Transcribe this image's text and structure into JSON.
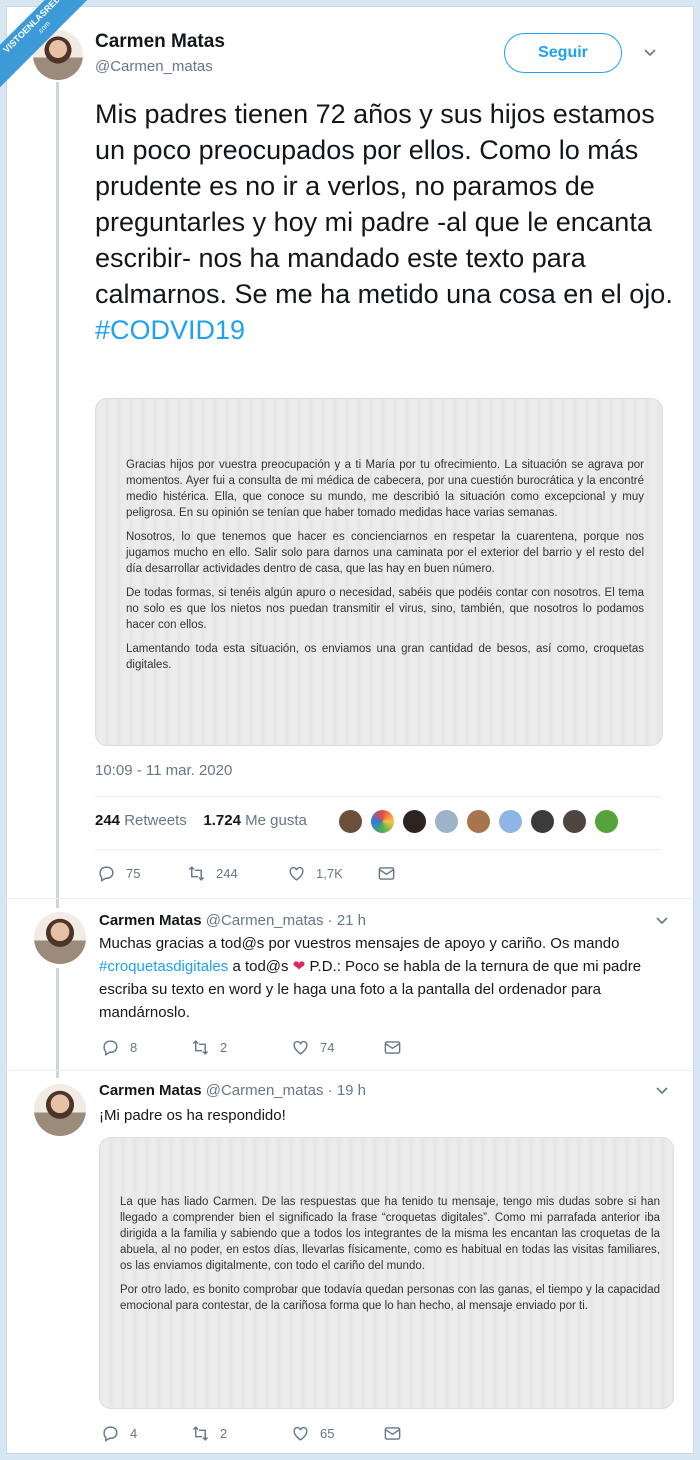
{
  "watermark": {
    "text": "VISTOENLASREDES",
    "sub": ".com"
  },
  "main_tweet": {
    "author_name": "Carmen Matas",
    "author_handle": "@Carmen_matas",
    "follow_label": "Seguir",
    "text": "Mis padres tienen 72 años y sus hijos estamos un poco preocupados por ellos. Como lo más prudente es no ir a verlos, no paramos de preguntarles y hoy mi padre -al que le encanta escribir- nos ha mandado este texto para calmarnos. Se me ha metido una cosa en el ojo.",
    "hashtag": "#CODVID19",
    "photo_paragraphs": [
      "Gracias hijos por vuestra preocupación y a ti María por tu ofrecimiento. La situación se agrava por momentos. Ayer fui a consulta de mi médica de cabecera, por una cuestión burocrática y la encontré medio histérica. Ella, que conoce su mundo, me describió la situación como excepcional y muy peligrosa. En su opinión se tenían que haber tomado medidas hace varias semanas.",
      "Nosotros, lo que tenemos que hacer es concienciarnos en respetar la cuarentena, porque nos jugamos mucho en ello. Salir solo para darnos una caminata por el exterior del barrio y el resto del día desarrollar actividades dentro de casa, que las hay en buen número.",
      "De todas formas, si tenéis algún apuro o necesidad, sabéis que podéis contar con nosotros. El tema no solo es que los nietos nos puedan transmitir el virus, sino, también, que nosotros lo podamos hacer con ellos.",
      "Lamentando toda esta situación, os enviamos una gran cantidad de besos, así como, croquetas digitales."
    ],
    "timestamp": "10:09 - 11 mar. 2020",
    "retweets_count": "244",
    "retweets_label": "Retweets",
    "likes_count": "1.724",
    "likes_label": "Me gusta",
    "actions": {
      "reply": "75",
      "retweet": "244",
      "like": "1,7K"
    }
  },
  "reply1": {
    "author_name": "Carmen Matas",
    "author_handle": "@Carmen_matas",
    "time": "· 21 h",
    "text_before": "Muchas gracias a tod@s por vuestros mensajes de apoyo y cariño. Os mando",
    "hashtag": "#croquetasdigitales",
    "text_mid": "a tod@s",
    "heart": "❤",
    "text_after": "P.D.: Poco se habla de la ternura de que mi padre escriba su texto en word y le haga una foto a la pantalla del ordenador para mandárnoslo.",
    "actions": {
      "reply": "8",
      "retweet": "2",
      "like": "74"
    }
  },
  "reply2": {
    "author_name": "Carmen Matas",
    "author_handle": "@Carmen_matas",
    "time": "· 19 h",
    "text": "¡Mi padre os ha respondido!",
    "photo_paragraphs": [
      "La que has liado Carmen. De las respuestas que ha tenido tu mensaje, tengo mis dudas sobre si han llegado a comprender bien el significado la frase “croquetas digitales”. Como mi parrafada anterior iba dirigida a la familia y sabiendo que a todos los integrantes de la misma les encantan las croquetas de la abuela, al no poder, en estos días, llevarlas físicamente, como es habitual en todas las visitas familiares, os las enviamos digitalmente, con todo el cariño del mundo.",
      "Por otro lado, es bonito comprobar que todavía quedan personas con las ganas, el tiempo y la capacidad emocional para contestar, de la cariñosa forma que lo han hecho, al mensaje enviado por ti."
    ],
    "actions": {
      "reply": "4",
      "retweet": "2",
      "like": "65"
    }
  },
  "colors": {
    "accent": "#1da1f2",
    "heart": "#e0245e",
    "muted": "#657786"
  }
}
